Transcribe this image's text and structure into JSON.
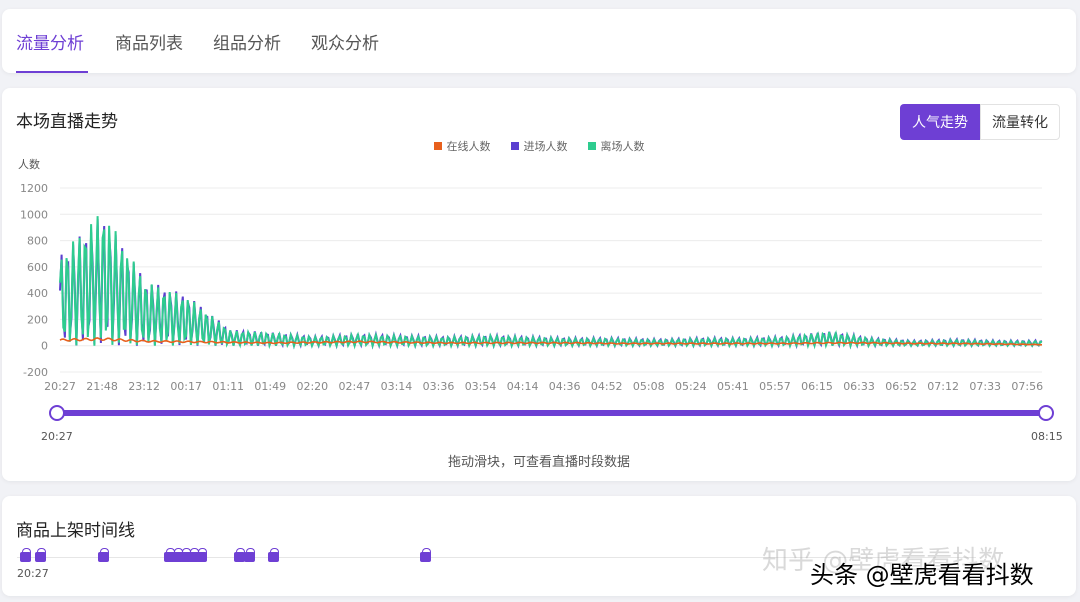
{
  "tabs": [
    {
      "label": "流量分析",
      "active": true
    },
    {
      "label": "商品列表",
      "active": false
    },
    {
      "label": "组品分析",
      "active": false
    },
    {
      "label": "观众分析",
      "active": false
    }
  ],
  "trend": {
    "title": "本场直播走势",
    "toggle_active": "人气走势",
    "toggle_inactive": "流量转化",
    "range_start": "20:27",
    "range_end": "08:15",
    "hint": "拖动滑块，可查看直播时段数据"
  },
  "timeline": {
    "title": "商品上架时间线",
    "start_label": "20:27",
    "bags": [
      1,
      2,
      3,
      4,
      5,
      6,
      7,
      8,
      9,
      10,
      11,
      12
    ]
  },
  "watermark": {
    "zhihu": "知乎 @壁虎看看抖数",
    "toutiao": "头条 @壁虎看看抖数"
  },
  "colors": {
    "accent": "#6e3fd4",
    "online": "#e8601c",
    "enter": "#5b3fd0",
    "leave": "#2ecc8f"
  },
  "chart_data": {
    "type": "line",
    "ylabel": "人数",
    "ylim": [
      -200,
      1200
    ],
    "yticks": [
      -200,
      0,
      200,
      400,
      600,
      800,
      1000,
      1200
    ],
    "categories": [
      "20:27",
      "21:48",
      "23:12",
      "00:17",
      "01:11",
      "01:49",
      "02:20",
      "02:47",
      "03:14",
      "03:36",
      "03:54",
      "04:14",
      "04:36",
      "04:52",
      "05:08",
      "05:24",
      "05:41",
      "05:57",
      "06:15",
      "06:33",
      "06:52",
      "07:12",
      "07:33",
      "07:56"
    ],
    "series": [
      {
        "name": "在线人数",
        "values": [
          50,
          60,
          40,
          35,
          30,
          25,
          30,
          35,
          30,
          25,
          25,
          25,
          25,
          20,
          20,
          20,
          20,
          20,
          25,
          25,
          20,
          20,
          15,
          10
        ]
      },
      {
        "name": "进场人数",
        "values": [
          700,
          1000,
          500,
          380,
          120,
          100,
          70,
          90,
          80,
          70,
          80,
          70,
          60,
          60,
          50,
          60,
          60,
          70,
          110,
          60,
          40,
          50,
          40,
          40
        ]
      },
      {
        "name": "离场人数",
        "values": [
          690,
          1040,
          490,
          370,
          115,
          95,
          65,
          85,
          75,
          65,
          75,
          65,
          55,
          55,
          45,
          55,
          55,
          65,
          105,
          55,
          35,
          45,
          35,
          35
        ]
      }
    ]
  }
}
